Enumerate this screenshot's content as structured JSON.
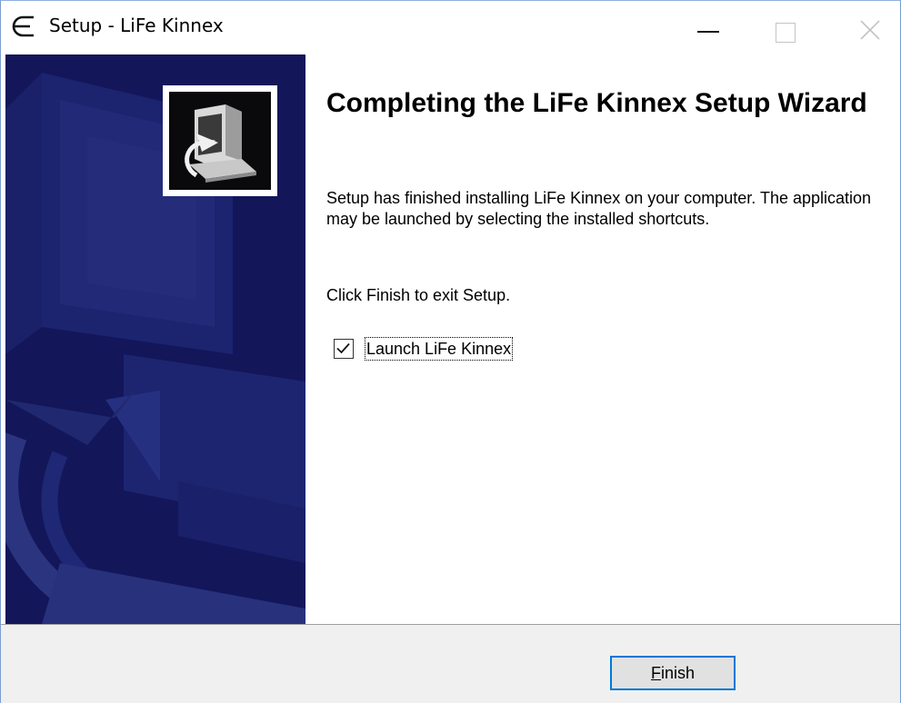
{
  "window": {
    "title": "Setup - LiFe Kinnex",
    "app_icon": "epsilon-app-icon",
    "controls": {
      "minimize_icon": "minimize-icon",
      "maximize_icon": "maximize-icon",
      "close_icon": "close-icon"
    }
  },
  "banner": {
    "logo_icon": "computer-install-icon",
    "background_color": "#131659"
  },
  "content": {
    "heading": "Completing the LiFe Kinnex Setup Wizard",
    "paragraph1": "Setup has finished installing LiFe Kinnex on your computer. The application may be launched by selecting the installed shortcuts.",
    "paragraph2": "Click Finish to exit Setup.",
    "launch_checkbox": {
      "label": "Launch LiFe Kinnex",
      "checked": true
    }
  },
  "footer": {
    "finish_button": {
      "accel": "F",
      "rest": "inish"
    },
    "accent_color": "#0078d7"
  }
}
